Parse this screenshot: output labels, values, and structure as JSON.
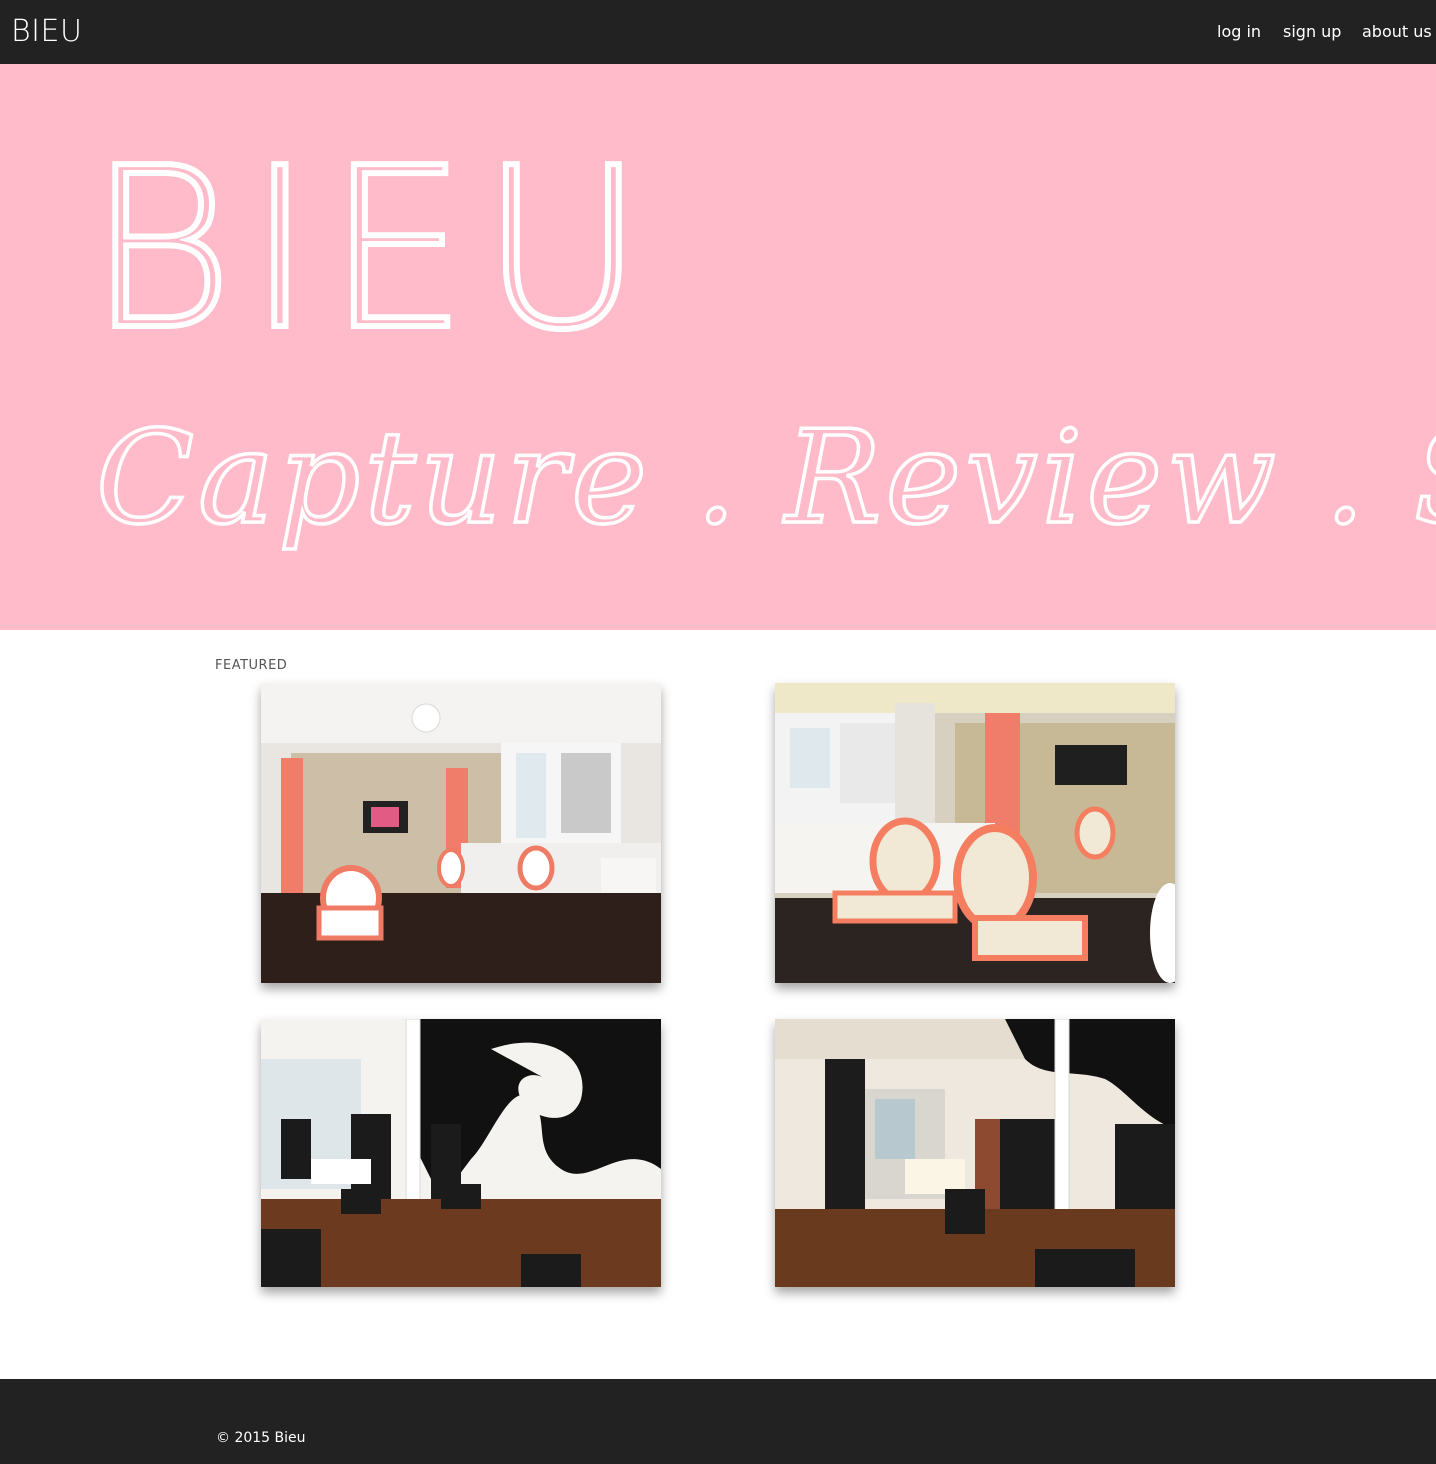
{
  "navbar": {
    "brand": "BIEU",
    "links": [
      {
        "label": "log in"
      },
      {
        "label": "sign up"
      },
      {
        "label": "about us"
      }
    ]
  },
  "hero": {
    "title": "BIEU",
    "tagline": "Capture . Review . Share .",
    "background_color": "#ffbbc9"
  },
  "featured": {
    "label": "FEATURED",
    "photos": [
      {
        "subject": "salon interior with pink accents and coral chairs"
      },
      {
        "subject": "salon vanity stations with coral oval chairs"
      },
      {
        "subject": "salon with black and white swirl mural"
      },
      {
        "subject": "salon aisle with black stations and wood floors"
      }
    ]
  },
  "footer": {
    "copyright": "© 2015 Bieu"
  },
  "colors": {
    "nav_bg": "#222222",
    "footer_bg": "#222222",
    "hero_bg": "#ffbbc9"
  }
}
